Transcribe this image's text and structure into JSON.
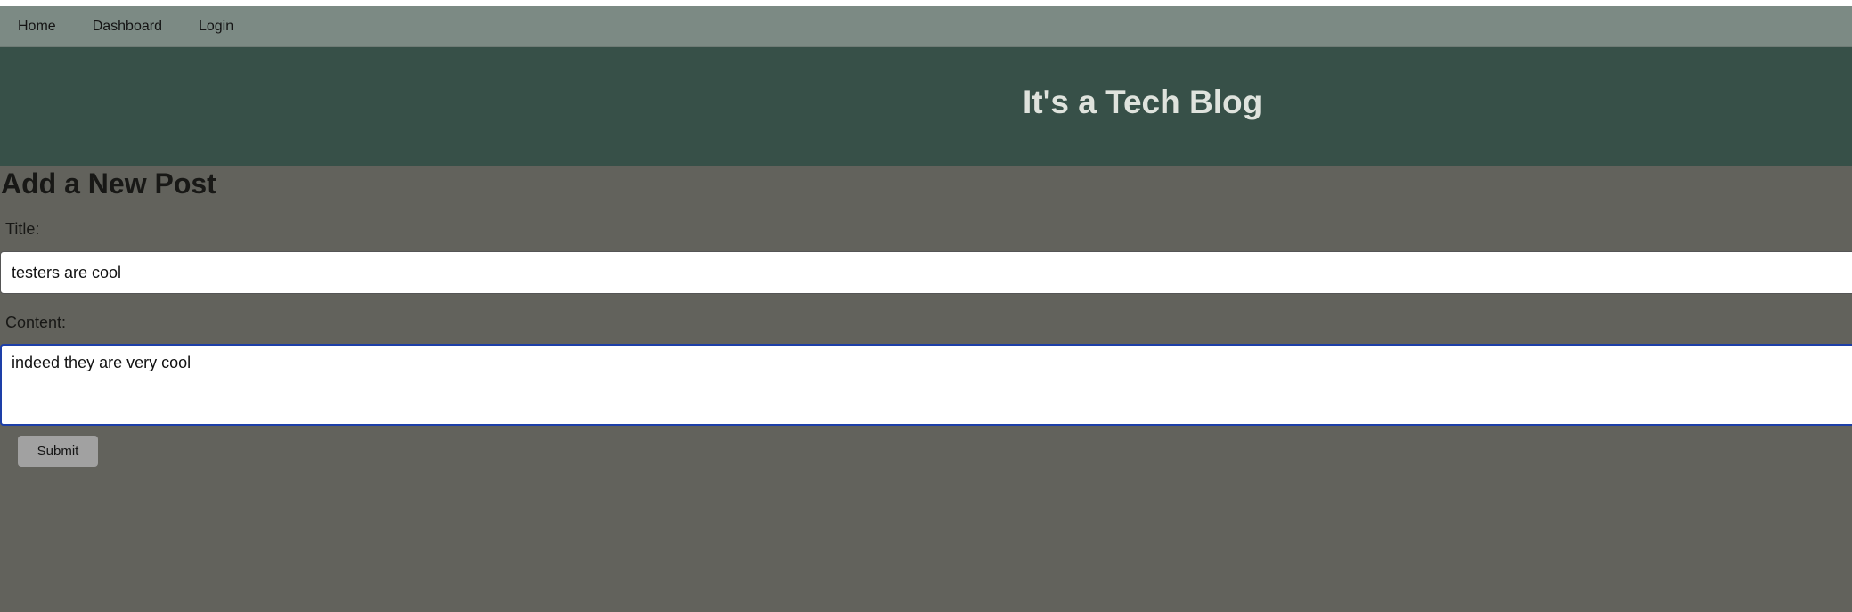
{
  "nav": {
    "items": [
      {
        "label": "Home"
      },
      {
        "label": "Dashboard"
      },
      {
        "label": "Login"
      }
    ]
  },
  "header": {
    "site_title": "It's a Tech Blog"
  },
  "main": {
    "page_title": "Add a New Post",
    "form": {
      "title_label": "Title:",
      "title_value": "testers are cool",
      "content_label": "Content:",
      "content_value": "indeed they are very cool",
      "submit_label": "Submit"
    }
  },
  "colors": {
    "nav_bg": "#7c8a84",
    "header_bg": "#375048",
    "page_bg": "#62625c",
    "focus_border": "#1d3fa8"
  }
}
